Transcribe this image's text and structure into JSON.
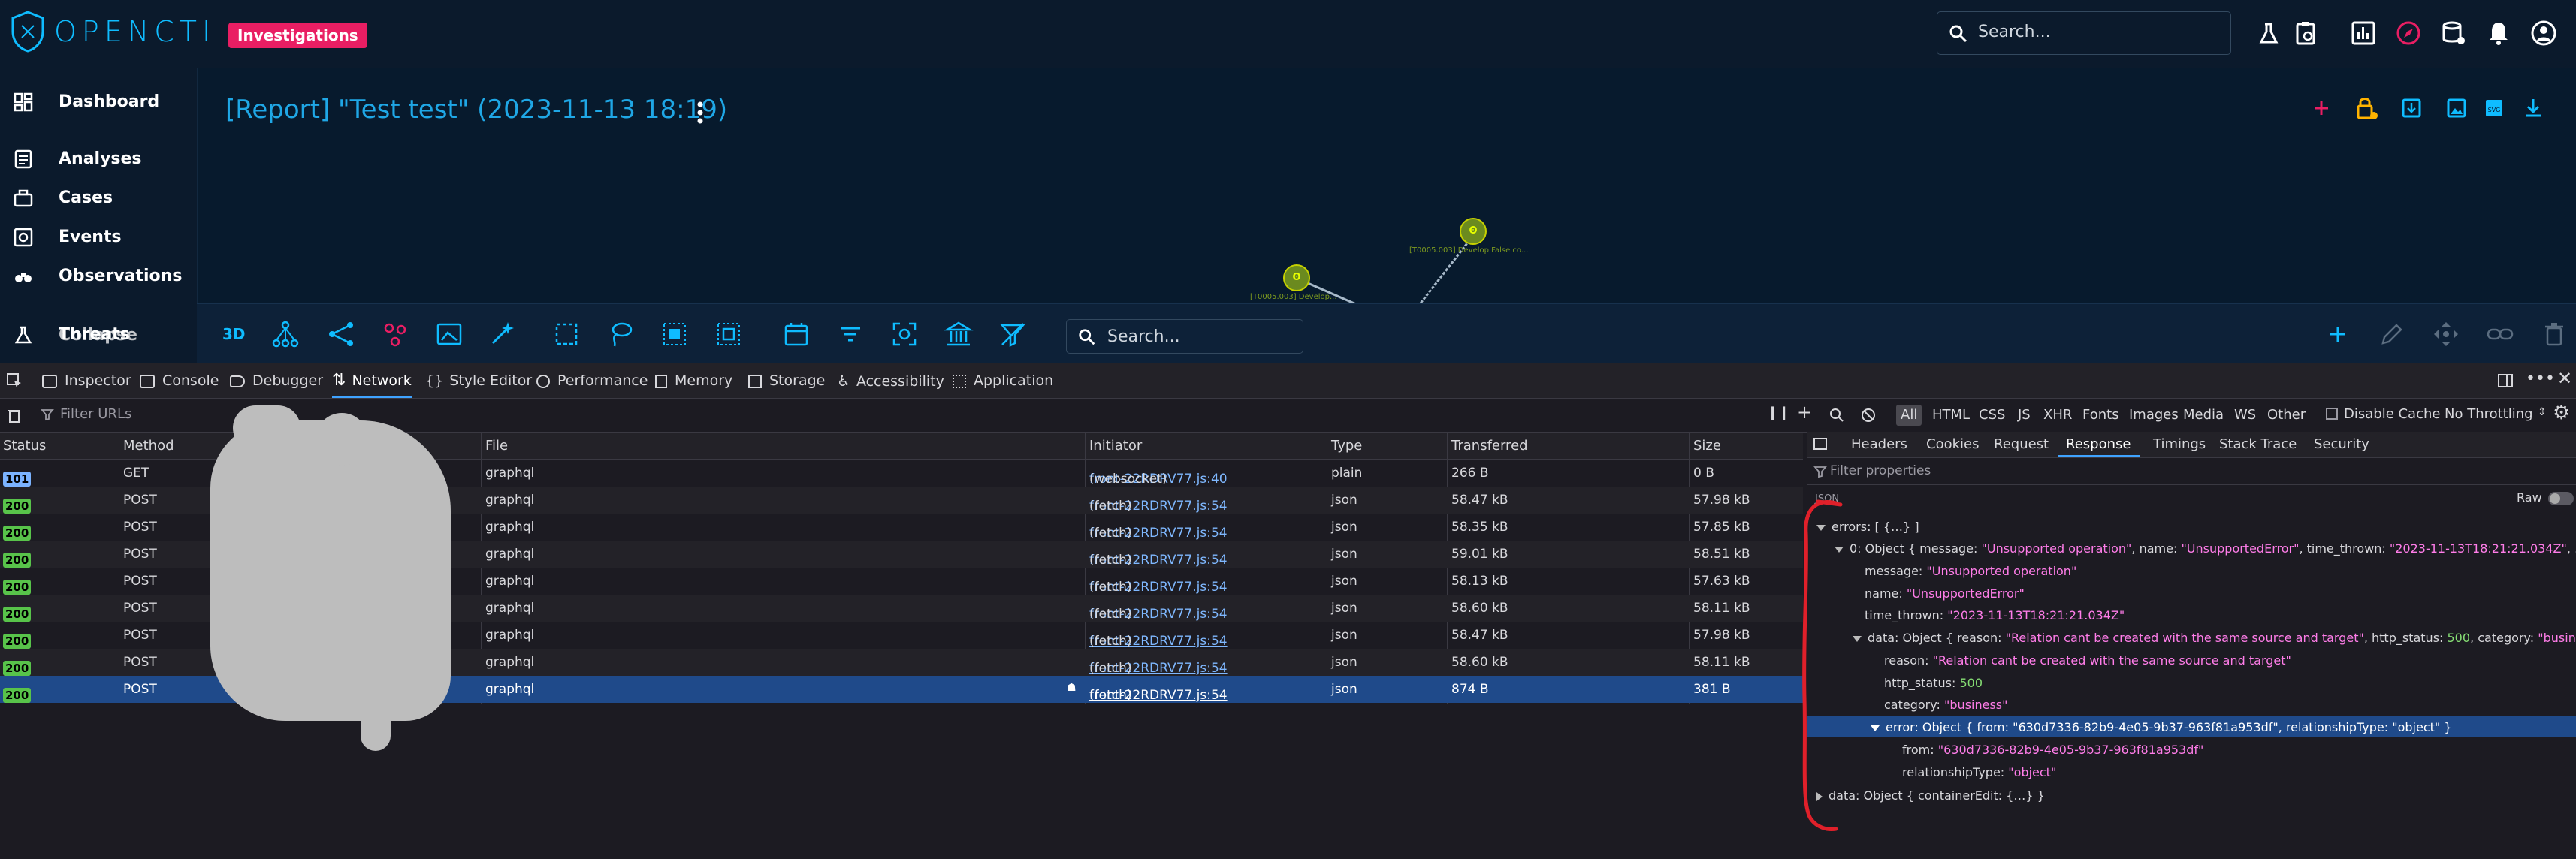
{
  "app": {
    "logo_text": "OPENCTI",
    "badge": "Investigations",
    "search_placeholder": "Search...",
    "sidebar": {
      "items": [
        {
          "label": "Dashboard",
          "icon": "dashboard-icon"
        },
        {
          "label": "Analyses",
          "icon": "analyses-icon"
        },
        {
          "label": "Cases",
          "icon": "cases-icon"
        },
        {
          "label": "Events",
          "icon": "events-icon"
        },
        {
          "label": "Observations",
          "icon": "observations-icon"
        },
        {
          "label": "Threats",
          "icon": "threats-icon"
        },
        {
          "label": "Collapse",
          "icon": "collapse-icon"
        }
      ]
    },
    "report_title": "[Report] \"Test test\" (2023-11-13 18:19)",
    "graph": {
      "node1_label": "[T0005.003] Develop False co...",
      "node2_label": "[T0005.003] Develop..."
    },
    "toolbar_3d": "3D",
    "graph_search_placeholder": "Search..."
  },
  "devtools": {
    "tabs": [
      "Inspector",
      "Console",
      "Debugger",
      "Network",
      "Style Editor",
      "Performance",
      "Memory",
      "Storage",
      "Accessibility",
      "Application"
    ],
    "filter_placeholder": "Filter URLs",
    "type_filters": [
      "All",
      "HTML",
      "CSS",
      "JS",
      "XHR",
      "Fonts",
      "Images",
      "Media",
      "WS",
      "Other"
    ],
    "disable_cache": "Disable Cache",
    "throttling": "No Throttling",
    "columns": {
      "status": "Status",
      "method": "Method",
      "file": "File",
      "initiator": "Initiator",
      "type": "Type",
      "transferred": "Transferred",
      "size": "Size"
    },
    "requests": [
      {
        "status": "101",
        "method": "GET",
        "file": "graphql",
        "initiator_link": "front-22RDRV77.js:40",
        "initiator_tail": "(websocket)",
        "type": "plain",
        "transferred": "266 B",
        "size": "0 B"
      },
      {
        "status": "200",
        "method": "POST",
        "file": "graphql",
        "initiator_link": "front-22RDRV77.js:54",
        "initiator_tail": "(fetch)",
        "type": "json",
        "transferred": "58.47 kB",
        "size": "57.98 kB"
      },
      {
        "status": "200",
        "method": "POST",
        "file": "graphql",
        "initiator_link": "front-22RDRV77.js:54",
        "initiator_tail": "(fetch)",
        "type": "json",
        "transferred": "58.35 kB",
        "size": "57.85 kB"
      },
      {
        "status": "200",
        "method": "POST",
        "file": "graphql",
        "initiator_link": "front-22RDRV77.js:54",
        "initiator_tail": "(fetch)",
        "type": "json",
        "transferred": "59.01 kB",
        "size": "58.51 kB"
      },
      {
        "status": "200",
        "method": "POST",
        "file": "graphql",
        "initiator_link": "front-22RDRV77.js:54",
        "initiator_tail": "(fetch)",
        "type": "json",
        "transferred": "58.13 kB",
        "size": "57.63 kB"
      },
      {
        "status": "200",
        "method": "POST",
        "file": "graphql",
        "initiator_link": "front-22RDRV77.js:54",
        "initiator_tail": "(fetch)",
        "type": "json",
        "transferred": "58.60 kB",
        "size": "58.11 kB"
      },
      {
        "status": "200",
        "method": "POST",
        "file": "graphql",
        "initiator_link": "front-22RDRV77.js:54",
        "initiator_tail": "(fetch)",
        "type": "json",
        "transferred": "58.47 kB",
        "size": "57.98 kB"
      },
      {
        "status": "200",
        "method": "POST",
        "file": "graphql",
        "initiator_link": "front-22RDRV77.js:54",
        "initiator_tail": "(fetch)",
        "type": "json",
        "transferred": "58.60 kB",
        "size": "58.11 kB"
      },
      {
        "status": "200",
        "method": "POST",
        "file": "graphql",
        "initiator_link": "front-22RDRV77.js:54",
        "initiator_tail": "(fetch)",
        "type": "json",
        "transferred": "874 B",
        "size": "381 B"
      }
    ],
    "panel": {
      "tabs": [
        "Headers",
        "Cookies",
        "Request",
        "Response",
        "Timings",
        "Stack Trace",
        "Security"
      ],
      "filter_placeholder": "Filter properties",
      "json_label": "JSON",
      "raw_label": "Raw",
      "lines": {
        "errors": "errors: [ {…} ]",
        "item0_key": "0: Object { message: ",
        "item0_msg": "\"Unsupported operation\"",
        "item0_mid": ", name: ",
        "item0_name": "\"UnsupportedError\"",
        "item0_mid2": ", time_thrown: ",
        "item0_time": "\"2023-11-13T18:21:21.034Z\"",
        "item0_end": ", … }",
        "message_key": "message: ",
        "message_val": "\"Unsupported operation\"",
        "name_key": "name: ",
        "name_val": "\"UnsupportedError\"",
        "time_key": "time_thrown: ",
        "time_val": "\"2023-11-13T18:21:21.034Z\"",
        "data_key": "data: Object { reason: ",
        "data_reason": "\"Relation cant be created with the same source and target\"",
        "data_mid": ", http_status: ",
        "data_status": "500",
        "data_mid2": ", category: ",
        "data_cat": "\"business\"",
        "data_end": ", … }",
        "reason_key": "reason: ",
        "reason_val": "\"Relation cant be created with the same source and target\"",
        "status_key": "http_status: ",
        "status_val": "500",
        "cat_key": "category: ",
        "cat_val": "\"business\"",
        "error_key": "error: Object { from: ",
        "error_from": "\"630d7336-82b9-4e05-9b37-963f81a953df\"",
        "error_mid": ", relationshipType: ",
        "error_rel": "\"object\"",
        "error_end": " }",
        "from_key": "from: ",
        "from_val": "\"630d7336-82b9-4e05-9b37-963f81a953df\"",
        "rel_key": "relationshipType: ",
        "rel_val": "\"object\"",
        "data2": "data: Object { containerEdit: {…} }"
      }
    }
  },
  "colors": {
    "accent": "#0fbcff",
    "badge": "#e91e63",
    "selected_row": "#1f4a8a",
    "annotation": "#e0202a"
  }
}
